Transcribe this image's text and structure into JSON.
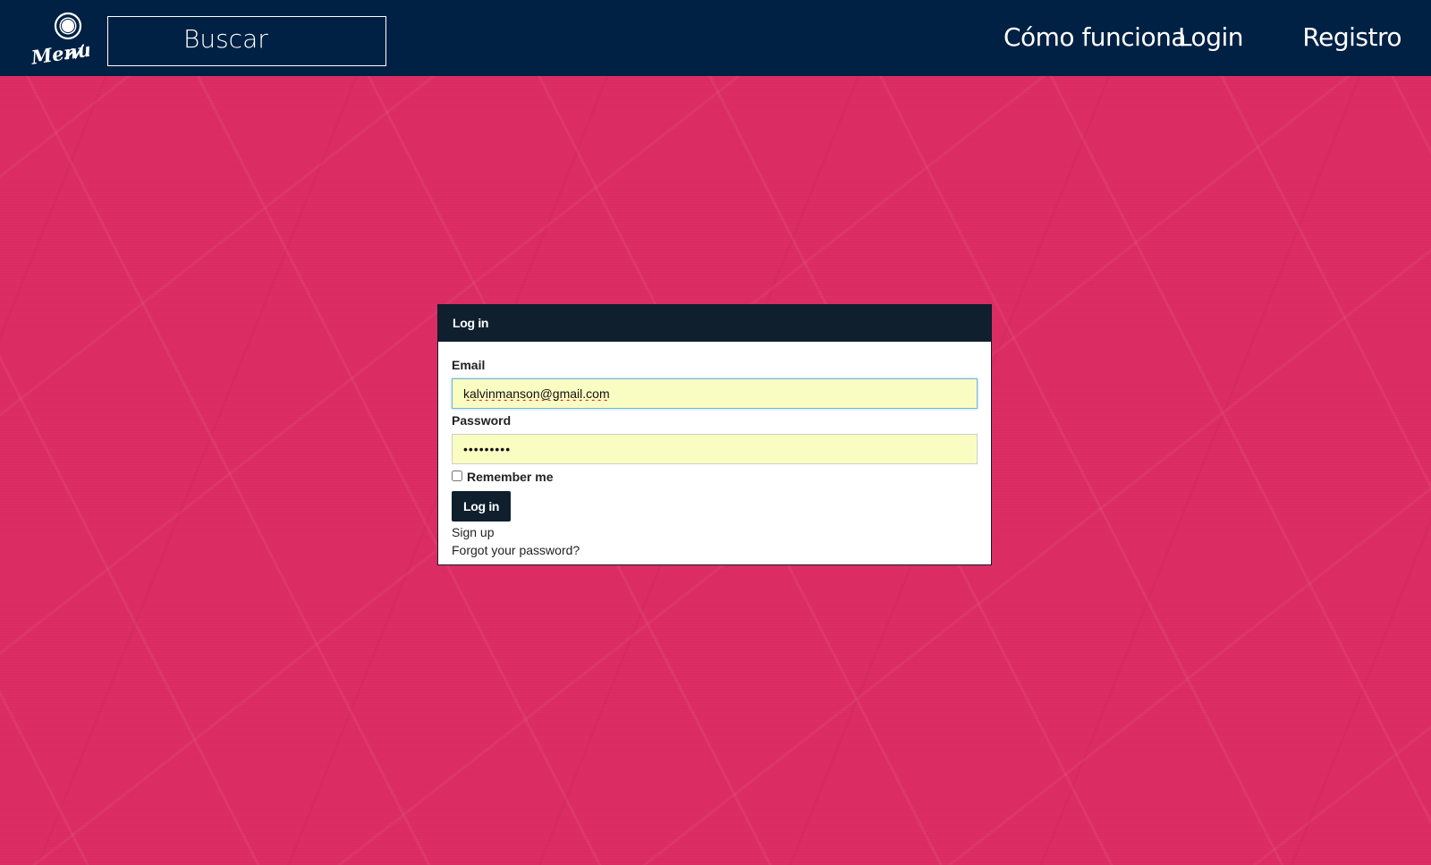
{
  "header": {
    "logo_text": "Menu",
    "search_label": "Buscar",
    "nav": {
      "how_it_works": "Cómo funciona",
      "login": "Login",
      "register": "Registro"
    }
  },
  "login_panel": {
    "title": "Log in",
    "email_label": "Email",
    "email_value": "kalvinmanson@gmail.com",
    "password_label": "Password",
    "password_masked": "•••••••••",
    "remember_label": "Remember me",
    "remember_checked": false,
    "submit_label": "Log in",
    "signup_link": "Sign up",
    "forgot_link": "Forgot your password?"
  },
  "colors": {
    "navbar": "#002144",
    "background": "#dd2d64",
    "panel_header": "#0f1f2e",
    "autofill": "#fafdc1"
  }
}
